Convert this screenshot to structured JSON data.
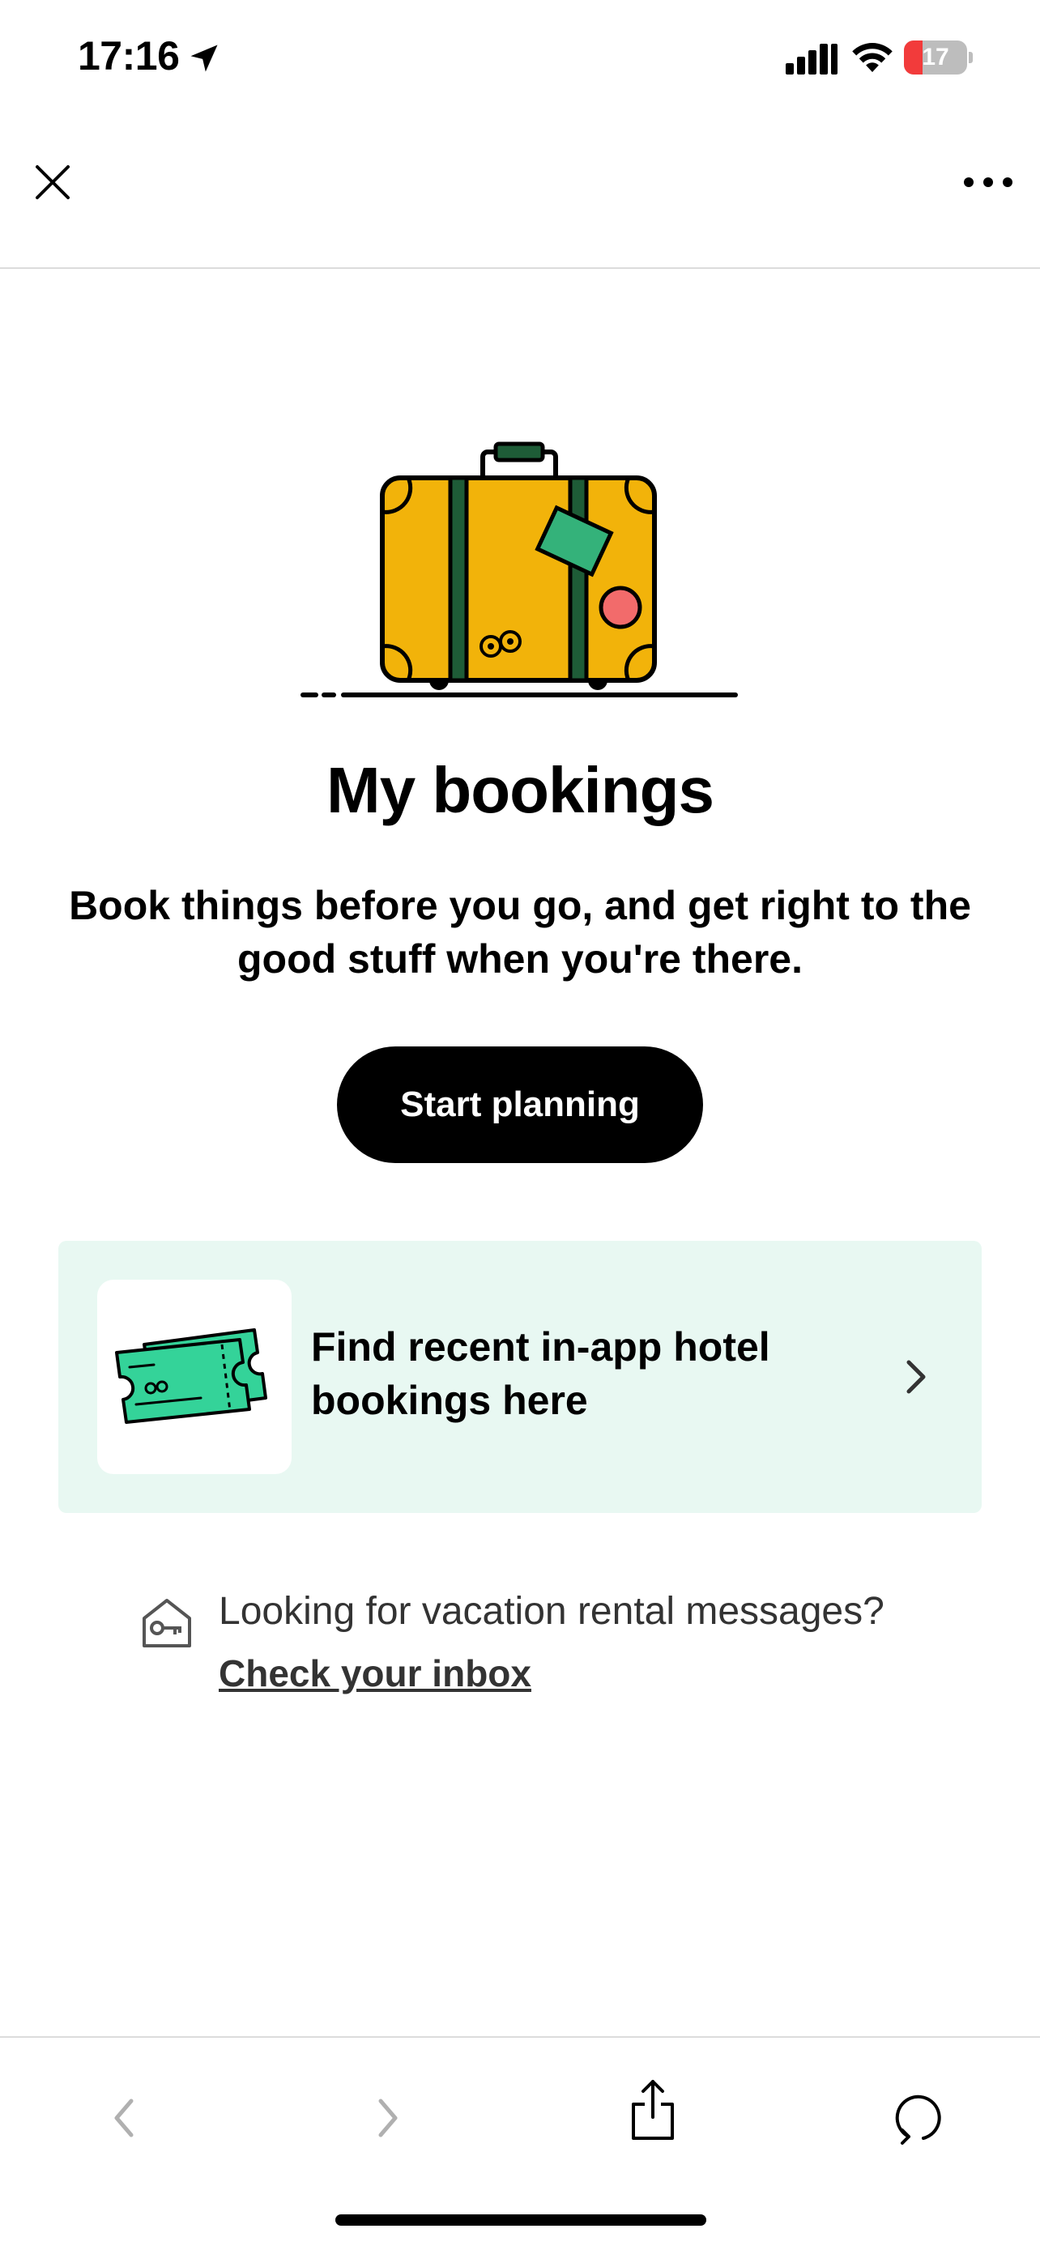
{
  "status_bar": {
    "time": "17:16",
    "battery_level": "17",
    "battery_color": "#f23b3b"
  },
  "nav": {
    "close_icon": "close-icon",
    "more_icon": "more-horizontal-icon"
  },
  "hero": {
    "illustration": "suitcase-illustration",
    "title": "My bookings",
    "subtitle": "Book things before you go, and get right to the good stuff when you're there.",
    "cta_label": "Start planning"
  },
  "hotel_card": {
    "text": "Find recent in-app hotel bookings here",
    "icon": "tickets-icon",
    "background": "#e8f8f2"
  },
  "rental": {
    "icon": "house-key-icon",
    "prompt": "Looking for vacation rental messages?",
    "link_label": "Check your inbox"
  },
  "toolbar": {
    "back_icon": "chevron-left-icon",
    "forward_icon": "chevron-right-icon",
    "share_icon": "share-icon",
    "refresh_icon": "refresh-icon"
  },
  "colors": {
    "accent": "#000000",
    "suitcase": "#f2b30a",
    "strap": "#1e5c37",
    "ticket": "#34d399"
  }
}
